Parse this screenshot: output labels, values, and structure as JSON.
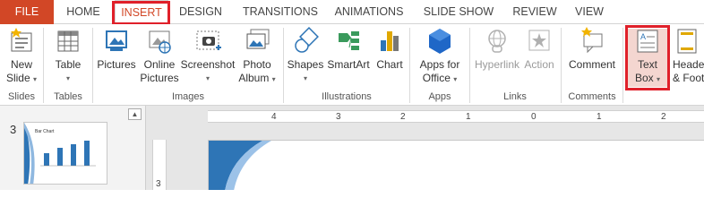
{
  "tabs": [
    "FILE",
    "HOME",
    "INSERT",
    "DESIGN",
    "TRANSITIONS",
    "ANIMATIONS",
    "SLIDE SHOW",
    "REVIEW",
    "VIEW"
  ],
  "ribbon": {
    "new_slide": [
      "New",
      "Slide"
    ],
    "table": "Table",
    "pictures": "Pictures",
    "online_pictures": [
      "Online",
      "Pictures"
    ],
    "screenshot": "Screenshot",
    "photo_album": [
      "Photo",
      "Album"
    ],
    "shapes": "Shapes",
    "smartart": "SmartArt",
    "chart": "Chart",
    "apps_for_office": [
      "Apps for",
      "Office"
    ],
    "hyperlink": "Hyperlink",
    "action": "Action",
    "comment": "Comment",
    "text_box": [
      "Text",
      "Box"
    ],
    "header_footer": [
      "Header",
      "& Foote"
    ],
    "caret": "▾",
    "groups": {
      "slides": "Slides",
      "tables": "Tables",
      "images": "Images",
      "illustrations": "Illustrations",
      "apps": "Apps",
      "links": "Links",
      "comments": "Comments"
    }
  },
  "slides_panel": {
    "slide_number": "3",
    "thumb_title": "Bar Chart",
    "collapse_glyph": "▲"
  },
  "ruler": {
    "labels": [
      "4",
      "3",
      "2",
      "1",
      "0",
      "1",
      "2"
    ],
    "vertical_label": "3"
  },
  "colors": {
    "accent": "#d24726",
    "highlight": "#e0202a",
    "ribbon_blue": "#2e75b6"
  }
}
